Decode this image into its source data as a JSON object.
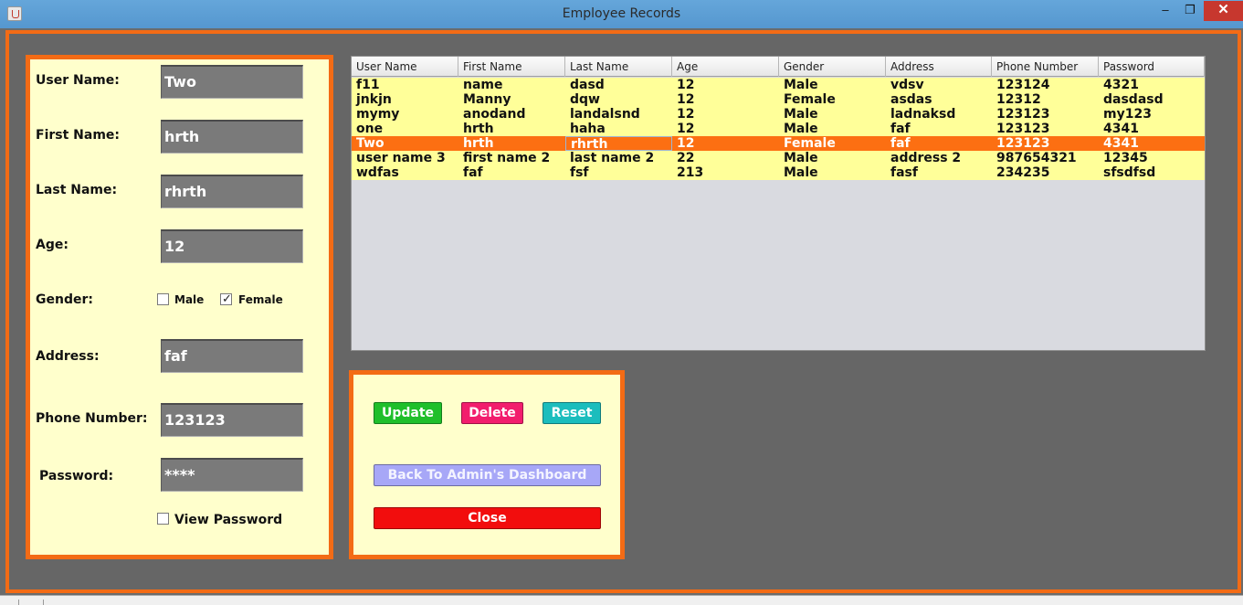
{
  "window": {
    "title": "Employee Records",
    "min_glyph": "–",
    "max_glyph": "❐",
    "close_glyph": "✕"
  },
  "form": {
    "user_name": {
      "label": "User Name:",
      "value": "Two"
    },
    "first_name": {
      "label": "First Name:",
      "value": "hrth"
    },
    "last_name": {
      "label": "Last Name:",
      "value": "rhrth"
    },
    "age": {
      "label": "Age:",
      "value": "12"
    },
    "gender": {
      "label": "Gender:",
      "male_label": "Male",
      "female_label": "Female",
      "male_checked": false,
      "female_checked": true
    },
    "address": {
      "label": "Address:",
      "value": "faf"
    },
    "phone": {
      "label": "Phone Number:",
      "value": "123123"
    },
    "password": {
      "label": "Password:",
      "value": "****"
    },
    "view_password": {
      "label": "View Password",
      "checked": false
    }
  },
  "table": {
    "columns": [
      "User Name",
      "First Name",
      "Last Name",
      "Age",
      "Gender",
      "Address",
      "Phone Number",
      "Password"
    ],
    "rows": [
      [
        "f11",
        "name",
        "dasd",
        "12",
        "Male",
        "vdsv",
        "123124",
        "4321"
      ],
      [
        "jnkjn",
        "Manny",
        "dqw",
        "12",
        "Female",
        "asdas",
        "12312",
        "dasdasd"
      ],
      [
        "mymy",
        "anodand",
        "landalsnd",
        "12",
        "Male",
        "ladnaksd",
        "123123",
        "my123"
      ],
      [
        "one",
        "hrth",
        "haha",
        "12",
        "Male",
        "faf",
        "123123",
        "4341"
      ],
      [
        "Two",
        "hrth",
        "rhrth",
        "12",
        "Female",
        "faf",
        "123123",
        "4341"
      ],
      [
        "user name 3",
        "first name 2",
        "last name 2",
        "22",
        "Male",
        "address 2",
        "987654321",
        "12345"
      ],
      [
        "wdfas",
        "faf",
        "fsf",
        "213",
        "Male",
        "fasf",
        "234235",
        "sfsdfsd"
      ]
    ],
    "selected_row": 4
  },
  "actions": {
    "update": "Update",
    "delete": "Delete",
    "reset": "Reset",
    "back": "Back To Admin's Dashboard",
    "close": "Close"
  },
  "colors": {
    "accent_orange": "#f36b15",
    "panel_bg": "#ffffcc",
    "row_bg": "#ffff99",
    "selected_row_bg": "#fc6f12",
    "update_btn": "#1fbf2b",
    "delete_btn": "#f21d6d",
    "reset_btn": "#1bbdbd",
    "back_btn": "#a7a7f7",
    "close_btn": "#f20d0d"
  }
}
